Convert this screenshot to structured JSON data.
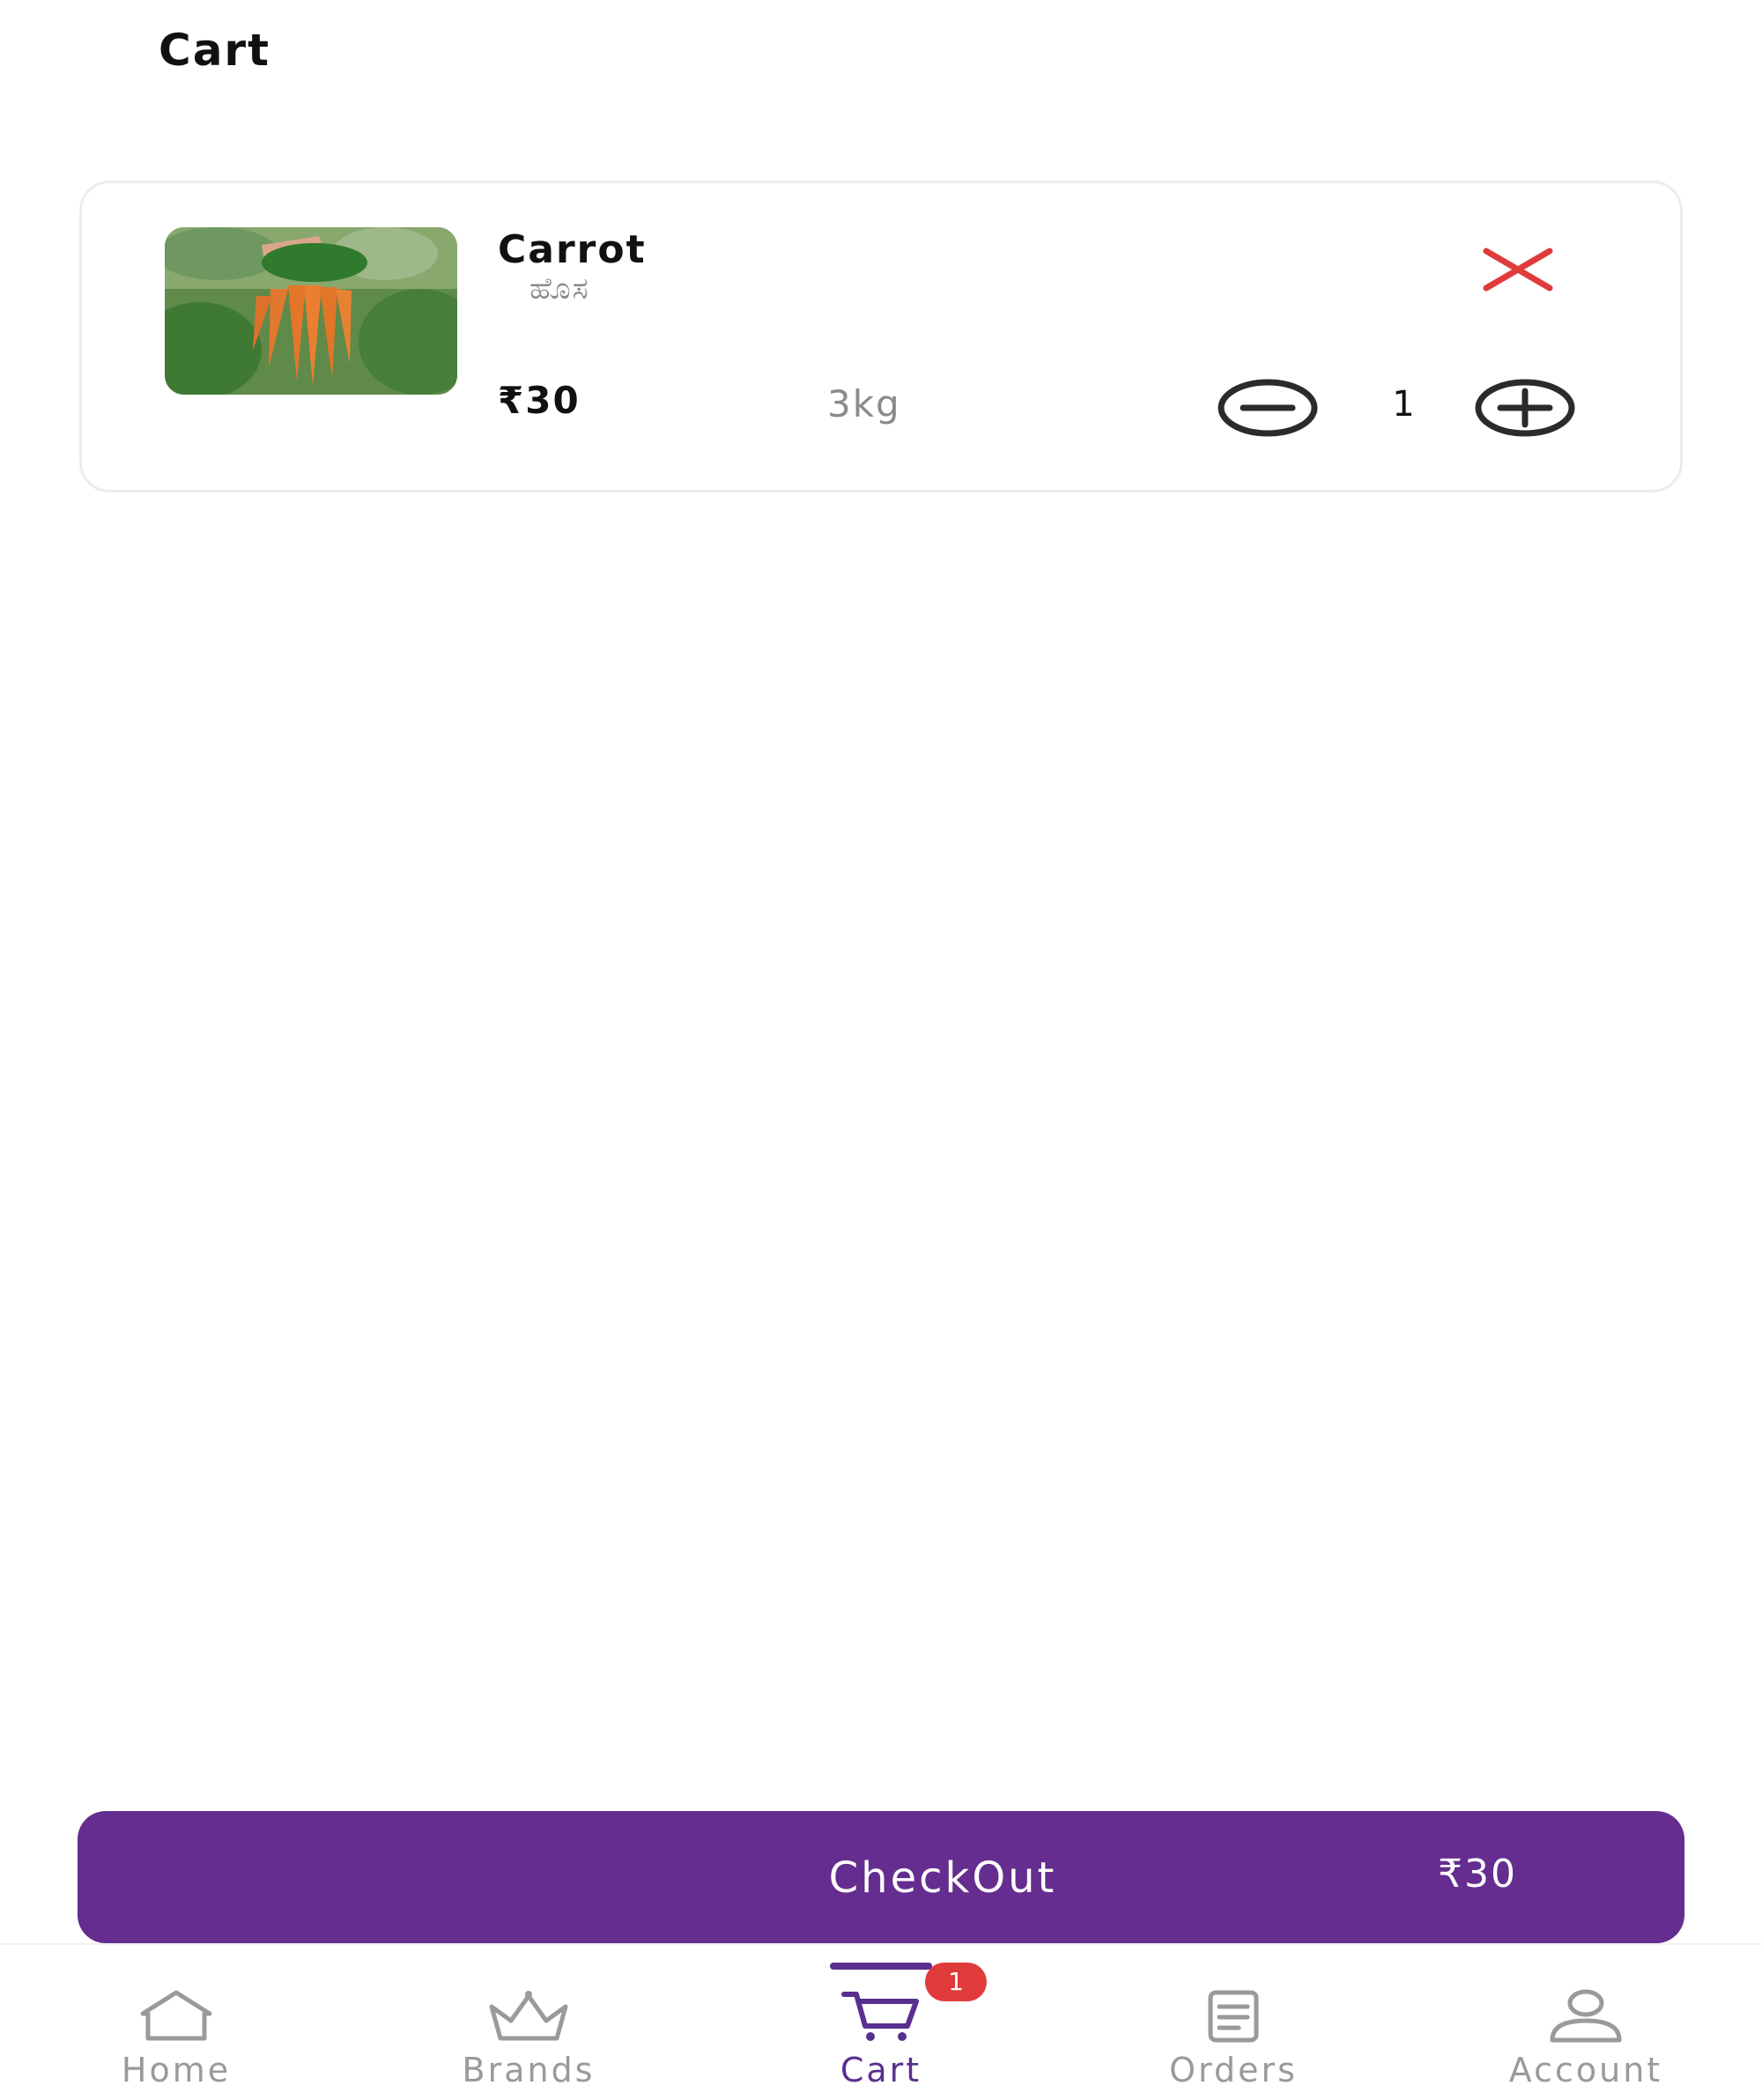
{
  "header": {
    "title": "Cart"
  },
  "cart": {
    "items": [
      {
        "name": "Carrot",
        "local_name": "ಹೊಸ",
        "price": "₹30",
        "weight": "3kg",
        "quantity": "1",
        "image_icon": "carrot-bunch-photo"
      }
    ]
  },
  "checkout": {
    "label": "CheckOut",
    "total": "₹30"
  },
  "bottom_nav": {
    "items": [
      {
        "label": "Home",
        "icon": "home-icon"
      },
      {
        "label": "Brands",
        "icon": "crown-icon"
      },
      {
        "label": "Cart",
        "icon": "cart-icon",
        "badge": "1",
        "active": true
      },
      {
        "label": "Orders",
        "icon": "orders-icon"
      },
      {
        "label": "Account",
        "icon": "account-icon"
      }
    ]
  },
  "colors": {
    "accent": "#642d8f",
    "remove": "#e03b3b",
    "badge": "#e03b3b",
    "nav_inactive": "#9a9a9a"
  }
}
